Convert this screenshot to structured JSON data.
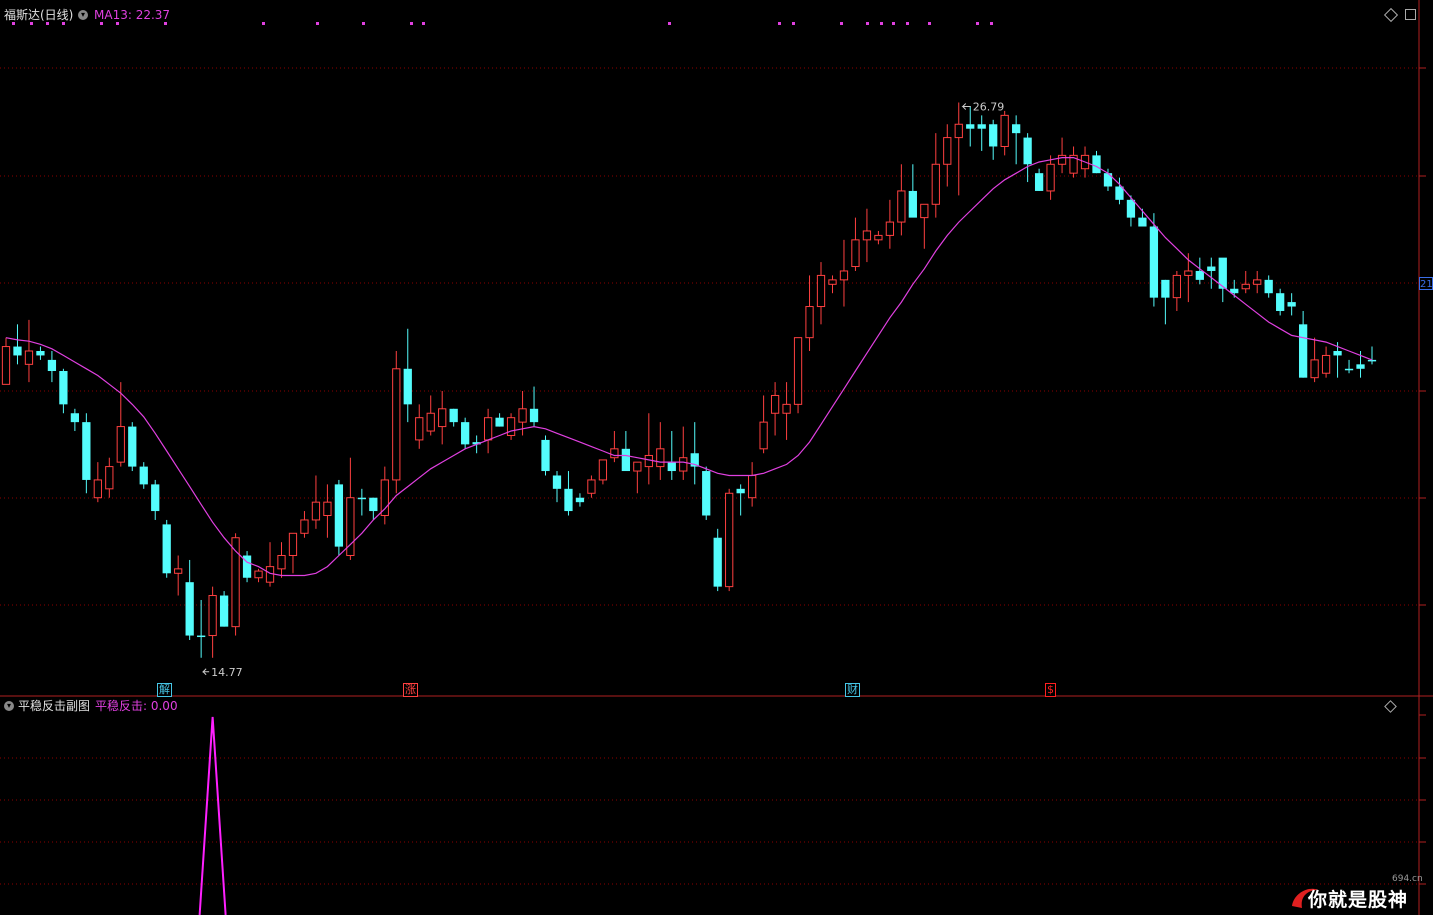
{
  "header": {
    "stock_title": "福斯达(日线)",
    "ma_label": "MA13: 22.37"
  },
  "subchart": {
    "title": "平稳反击副图",
    "value_label": "平稳反击: 0.00"
  },
  "markers": [
    {
      "text": "解",
      "color": "#46c6e6"
    },
    {
      "text": "涨",
      "color": "#ff4040"
    },
    {
      "text": "财",
      "color": "#46c6e6"
    },
    {
      "text": "$",
      "color": "#ff2020"
    }
  ],
  "annotations": {
    "low": "14.77",
    "high": "26.79"
  },
  "right_axis_price": "21",
  "watermark": {
    "text": "你就是股神",
    "site": "694.cn"
  },
  "colors": {
    "up": "#ff4040",
    "down": "#54fcfc",
    "ma": "#e040e0",
    "grid": "#8b0000",
    "signal": "#ff20ff"
  },
  "chart_data": [
    {
      "type": "candlestick",
      "title": "福斯达(日线)",
      "ylim": [
        13.8,
        28.6
      ],
      "ohlc": [
        [
          20.45,
          21.5,
          20.52,
          21.3,
          "up"
        ],
        [
          21.3,
          21.8,
          20.9,
          21.1,
          "down"
        ],
        [
          20.9,
          21.9,
          20.5,
          21.2,
          "up"
        ],
        [
          21.2,
          21.3,
          21.0,
          21.1,
          "down"
        ],
        [
          21.0,
          21.2,
          20.5,
          20.75,
          "down"
        ],
        [
          20.75,
          20.8,
          19.8,
          20.0,
          "down"
        ],
        [
          19.8,
          19.9,
          19.4,
          19.6,
          "down"
        ],
        [
          19.6,
          19.8,
          18.0,
          18.3,
          "down"
        ],
        [
          17.9,
          18.7,
          17.8,
          18.3,
          "up"
        ],
        [
          18.1,
          18.8,
          17.9,
          18.6,
          "up"
        ],
        [
          18.7,
          20.5,
          18.6,
          19.5,
          "up"
        ],
        [
          19.5,
          19.6,
          18.5,
          18.6,
          "down"
        ],
        [
          18.6,
          18.7,
          18.1,
          18.2,
          "down"
        ],
        [
          18.2,
          18.3,
          17.4,
          17.6,
          "down"
        ],
        [
          17.3,
          17.4,
          16.1,
          16.2,
          "down"
        ],
        [
          16.2,
          16.6,
          15.7,
          16.3,
          "up"
        ],
        [
          16.0,
          16.5,
          14.7,
          14.8,
          "down"
        ],
        [
          14.8,
          15.6,
          14.3,
          14.8,
          "down"
        ],
        [
          14.8,
          15.9,
          14.3,
          15.7,
          "up"
        ],
        [
          15.7,
          15.8,
          15.0,
          15.0,
          "down"
        ],
        [
          15.0,
          17.1,
          14.8,
          17.0,
          "up"
        ],
        [
          16.6,
          16.7,
          16.0,
          16.1,
          "down"
        ],
        [
          16.1,
          16.3,
          16.0,
          16.25,
          "up"
        ],
        [
          16.0,
          16.9,
          15.9,
          16.35,
          "up"
        ],
        [
          16.3,
          16.9,
          16.1,
          16.6,
          "up"
        ],
        [
          16.6,
          17.0,
          16.2,
          17.1,
          "up"
        ],
        [
          17.1,
          17.6,
          17.0,
          17.4,
          "up"
        ],
        [
          17.4,
          18.4,
          17.2,
          17.8,
          "up"
        ],
        [
          17.8,
          18.2,
          17.0,
          17.5,
          "up"
        ],
        [
          18.2,
          18.3,
          16.6,
          16.8,
          "down"
        ],
        [
          16.6,
          18.8,
          16.5,
          17.9,
          "up"
        ],
        [
          17.9,
          18.1,
          17.5,
          17.9,
          "down"
        ],
        [
          17.9,
          17.9,
          17.4,
          17.6,
          "down"
        ],
        [
          17.5,
          18.6,
          17.3,
          18.3,
          "up"
        ],
        [
          18.3,
          21.2,
          18.0,
          20.8,
          "up"
        ],
        [
          20.8,
          21.7,
          19.6,
          20.0,
          "down"
        ],
        [
          19.7,
          20.0,
          19.0,
          19.2,
          "up"
        ],
        [
          19.4,
          20.2,
          19.3,
          19.8,
          "up"
        ],
        [
          19.5,
          20.3,
          19.1,
          19.9,
          "up"
        ],
        [
          19.9,
          19.9,
          19.5,
          19.6,
          "down"
        ],
        [
          19.6,
          19.7,
          19.0,
          19.1,
          "down"
        ],
        [
          19.1,
          19.3,
          18.9,
          19.15,
          "down"
        ],
        [
          19.2,
          19.9,
          18.9,
          19.7,
          "up"
        ],
        [
          19.7,
          19.8,
          19.5,
          19.5,
          "down"
        ],
        [
          19.3,
          19.8,
          19.2,
          19.7,
          "up"
        ],
        [
          19.6,
          20.3,
          19.3,
          19.9,
          "up"
        ],
        [
          19.9,
          20.4,
          19.5,
          19.6,
          "down"
        ],
        [
          19.2,
          19.3,
          18.4,
          18.5,
          "down"
        ],
        [
          18.4,
          18.5,
          17.8,
          18.1,
          "down"
        ],
        [
          18.1,
          18.5,
          17.5,
          17.6,
          "down"
        ],
        [
          17.8,
          18.0,
          17.7,
          17.9,
          "down"
        ],
        [
          18.0,
          18.4,
          17.9,
          18.3,
          "up"
        ],
        [
          18.3,
          18.7,
          18.2,
          18.75,
          "up"
        ],
        [
          18.8,
          19.4,
          18.7,
          19.0,
          "up"
        ],
        [
          19.0,
          19.4,
          18.6,
          18.5,
          "down"
        ],
        [
          18.5,
          18.6,
          18.0,
          18.7,
          "up"
        ],
        [
          18.6,
          19.8,
          18.2,
          18.85,
          "up"
        ],
        [
          19.0,
          19.6,
          18.3,
          18.6,
          "up"
        ],
        [
          18.7,
          19.4,
          18.3,
          18.5,
          "down"
        ],
        [
          18.5,
          19.5,
          18.3,
          18.8,
          "up"
        ],
        [
          18.9,
          19.6,
          18.2,
          18.6,
          "down"
        ],
        [
          18.5,
          18.6,
          17.4,
          17.5,
          "down"
        ],
        [
          17.0,
          17.2,
          15.8,
          15.9,
          "down"
        ],
        [
          15.9,
          18.1,
          15.8,
          18.0,
          "up"
        ],
        [
          18.0,
          18.2,
          17.5,
          18.1,
          "down"
        ],
        [
          17.9,
          18.7,
          17.7,
          18.4,
          "up"
        ],
        [
          19.0,
          20.2,
          18.9,
          19.6,
          "up"
        ],
        [
          19.8,
          20.5,
          19.3,
          20.2,
          "up"
        ],
        [
          19.8,
          20.5,
          19.2,
          20.0,
          "up"
        ],
        [
          20.0,
          21.5,
          19.8,
          21.5,
          "up"
        ],
        [
          21.5,
          22.9,
          21.2,
          22.2,
          "up"
        ],
        [
          22.2,
          23.2,
          21.8,
          22.9,
          "up"
        ],
        [
          22.7,
          22.9,
          22.5,
          22.8,
          "up"
        ],
        [
          22.8,
          23.7,
          22.2,
          23.0,
          "up"
        ],
        [
          23.1,
          24.2,
          23.0,
          23.7,
          "up"
        ],
        [
          23.7,
          24.4,
          23.2,
          23.9,
          "up"
        ],
        [
          23.7,
          23.9,
          23.6,
          23.8,
          "up"
        ],
        [
          23.8,
          24.6,
          23.5,
          24.1,
          "up"
        ],
        [
          24.1,
          25.4,
          23.8,
          24.8,
          "up"
        ],
        [
          24.8,
          25.4,
          24.5,
          24.2,
          "down"
        ],
        [
          24.2,
          24.5,
          23.5,
          24.5,
          "up"
        ],
        [
          24.5,
          26.1,
          24.2,
          25.4,
          "up"
        ],
        [
          25.4,
          26.3,
          24.9,
          26.0,
          "up"
        ],
        [
          26.0,
          26.79,
          24.7,
          26.3,
          "up"
        ],
        [
          26.3,
          26.7,
          25.8,
          26.2,
          "down"
        ],
        [
          26.2,
          26.5,
          25.7,
          26.3,
          "down"
        ],
        [
          26.3,
          26.4,
          25.5,
          25.8,
          "down"
        ],
        [
          25.8,
          26.6,
          25.6,
          26.5,
          "up"
        ],
        [
          26.3,
          26.5,
          25.4,
          26.1,
          "down"
        ],
        [
          26.0,
          26.1,
          25.0,
          25.4,
          "down"
        ],
        [
          25.2,
          25.3,
          24.8,
          24.8,
          "down"
        ],
        [
          24.8,
          25.6,
          24.6,
          25.4,
          "up"
        ],
        [
          25.4,
          26.0,
          25.2,
          25.6,
          "up"
        ],
        [
          25.2,
          25.8,
          25.1,
          25.6,
          "up"
        ],
        [
          25.6,
          25.8,
          25.1,
          25.3,
          "up"
        ],
        [
          25.6,
          25.7,
          25.2,
          25.2,
          "down"
        ],
        [
          25.2,
          25.3,
          24.8,
          24.9,
          "down"
        ],
        [
          24.9,
          25.1,
          24.5,
          24.6,
          "down"
        ],
        [
          24.6,
          24.7,
          24.0,
          24.2,
          "down"
        ],
        [
          24.2,
          24.4,
          24.0,
          24.0,
          "down"
        ],
        [
          24.0,
          24.3,
          22.2,
          22.4,
          "down"
        ],
        [
          22.4,
          22.8,
          21.8,
          22.8,
          "down"
        ],
        [
          22.4,
          23.0,
          22.1,
          22.9,
          "up"
        ],
        [
          22.9,
          23.4,
          22.3,
          23.0,
          "up"
        ],
        [
          23.0,
          23.3,
          22.7,
          22.8,
          "down"
        ],
        [
          23.0,
          23.3,
          22.6,
          23.1,
          "down"
        ],
        [
          23.3,
          23.0,
          22.3,
          22.6,
          "down"
        ],
        [
          22.6,
          22.8,
          22.4,
          22.5,
          "down"
        ],
        [
          22.6,
          23.0,
          22.5,
          22.7,
          "up"
        ],
        [
          22.7,
          23.0,
          22.5,
          22.8,
          "up"
        ],
        [
          22.8,
          22.9,
          22.4,
          22.5,
          "down"
        ],
        [
          22.5,
          22.6,
          22.0,
          22.1,
          "down"
        ],
        [
          22.2,
          22.5,
          22.0,
          22.3,
          "down"
        ],
        [
          21.8,
          22.1,
          20.6,
          20.6,
          "down"
        ],
        [
          20.6,
          21.5,
          20.5,
          21.0,
          "up"
        ],
        [
          20.7,
          21.3,
          20.6,
          21.1,
          "up"
        ],
        [
          21.2,
          21.4,
          20.6,
          21.1,
          "down"
        ],
        [
          20.8,
          21.0,
          20.7,
          20.8,
          "down"
        ],
        [
          20.9,
          21.2,
          20.6,
          20.8,
          "down"
        ],
        [
          21.0,
          21.3,
          20.9,
          21.0,
          "down"
        ]
      ],
      "ma13": [
        21.5,
        21.45,
        21.42,
        21.35,
        21.25,
        21.1,
        20.95,
        20.8,
        20.65,
        20.45,
        20.25,
        20.0,
        19.72,
        19.35,
        18.95,
        18.55,
        18.15,
        17.75,
        17.35,
        17.0,
        16.7,
        16.45,
        16.35,
        16.2,
        16.15,
        16.15,
        16.15,
        16.2,
        16.35,
        16.6,
        16.85,
        17.1,
        17.4,
        17.65,
        17.95,
        18.15,
        18.35,
        18.55,
        18.7,
        18.85,
        19.0,
        19.1,
        19.2,
        19.3,
        19.4,
        19.45,
        19.5,
        19.45,
        19.35,
        19.25,
        19.15,
        19.05,
        18.95,
        18.85,
        18.85,
        18.8,
        18.75,
        18.7,
        18.7,
        18.7,
        18.65,
        18.55,
        18.45,
        18.4,
        18.4,
        18.4,
        18.45,
        18.55,
        18.65,
        18.85,
        19.15,
        19.55,
        19.95,
        20.35,
        20.75,
        21.15,
        21.55,
        21.95,
        22.3,
        22.7,
        23.05,
        23.45,
        23.8,
        24.1,
        24.35,
        24.6,
        24.85,
        25.05,
        25.2,
        25.35,
        25.45,
        25.5,
        25.55,
        25.55,
        25.45,
        25.35,
        25.2,
        24.95,
        24.65,
        24.35,
        24.05,
        23.75,
        23.5,
        23.25,
        23.05,
        22.85,
        22.65,
        22.45,
        22.25,
        22.05,
        21.85,
        21.7,
        21.55,
        21.5,
        21.45,
        21.4,
        21.3,
        21.2,
        21.1,
        21.0
      ],
      "signal": {
        "type": "line",
        "values_hint": "spike",
        "spike_index": 18
      }
    }
  ]
}
